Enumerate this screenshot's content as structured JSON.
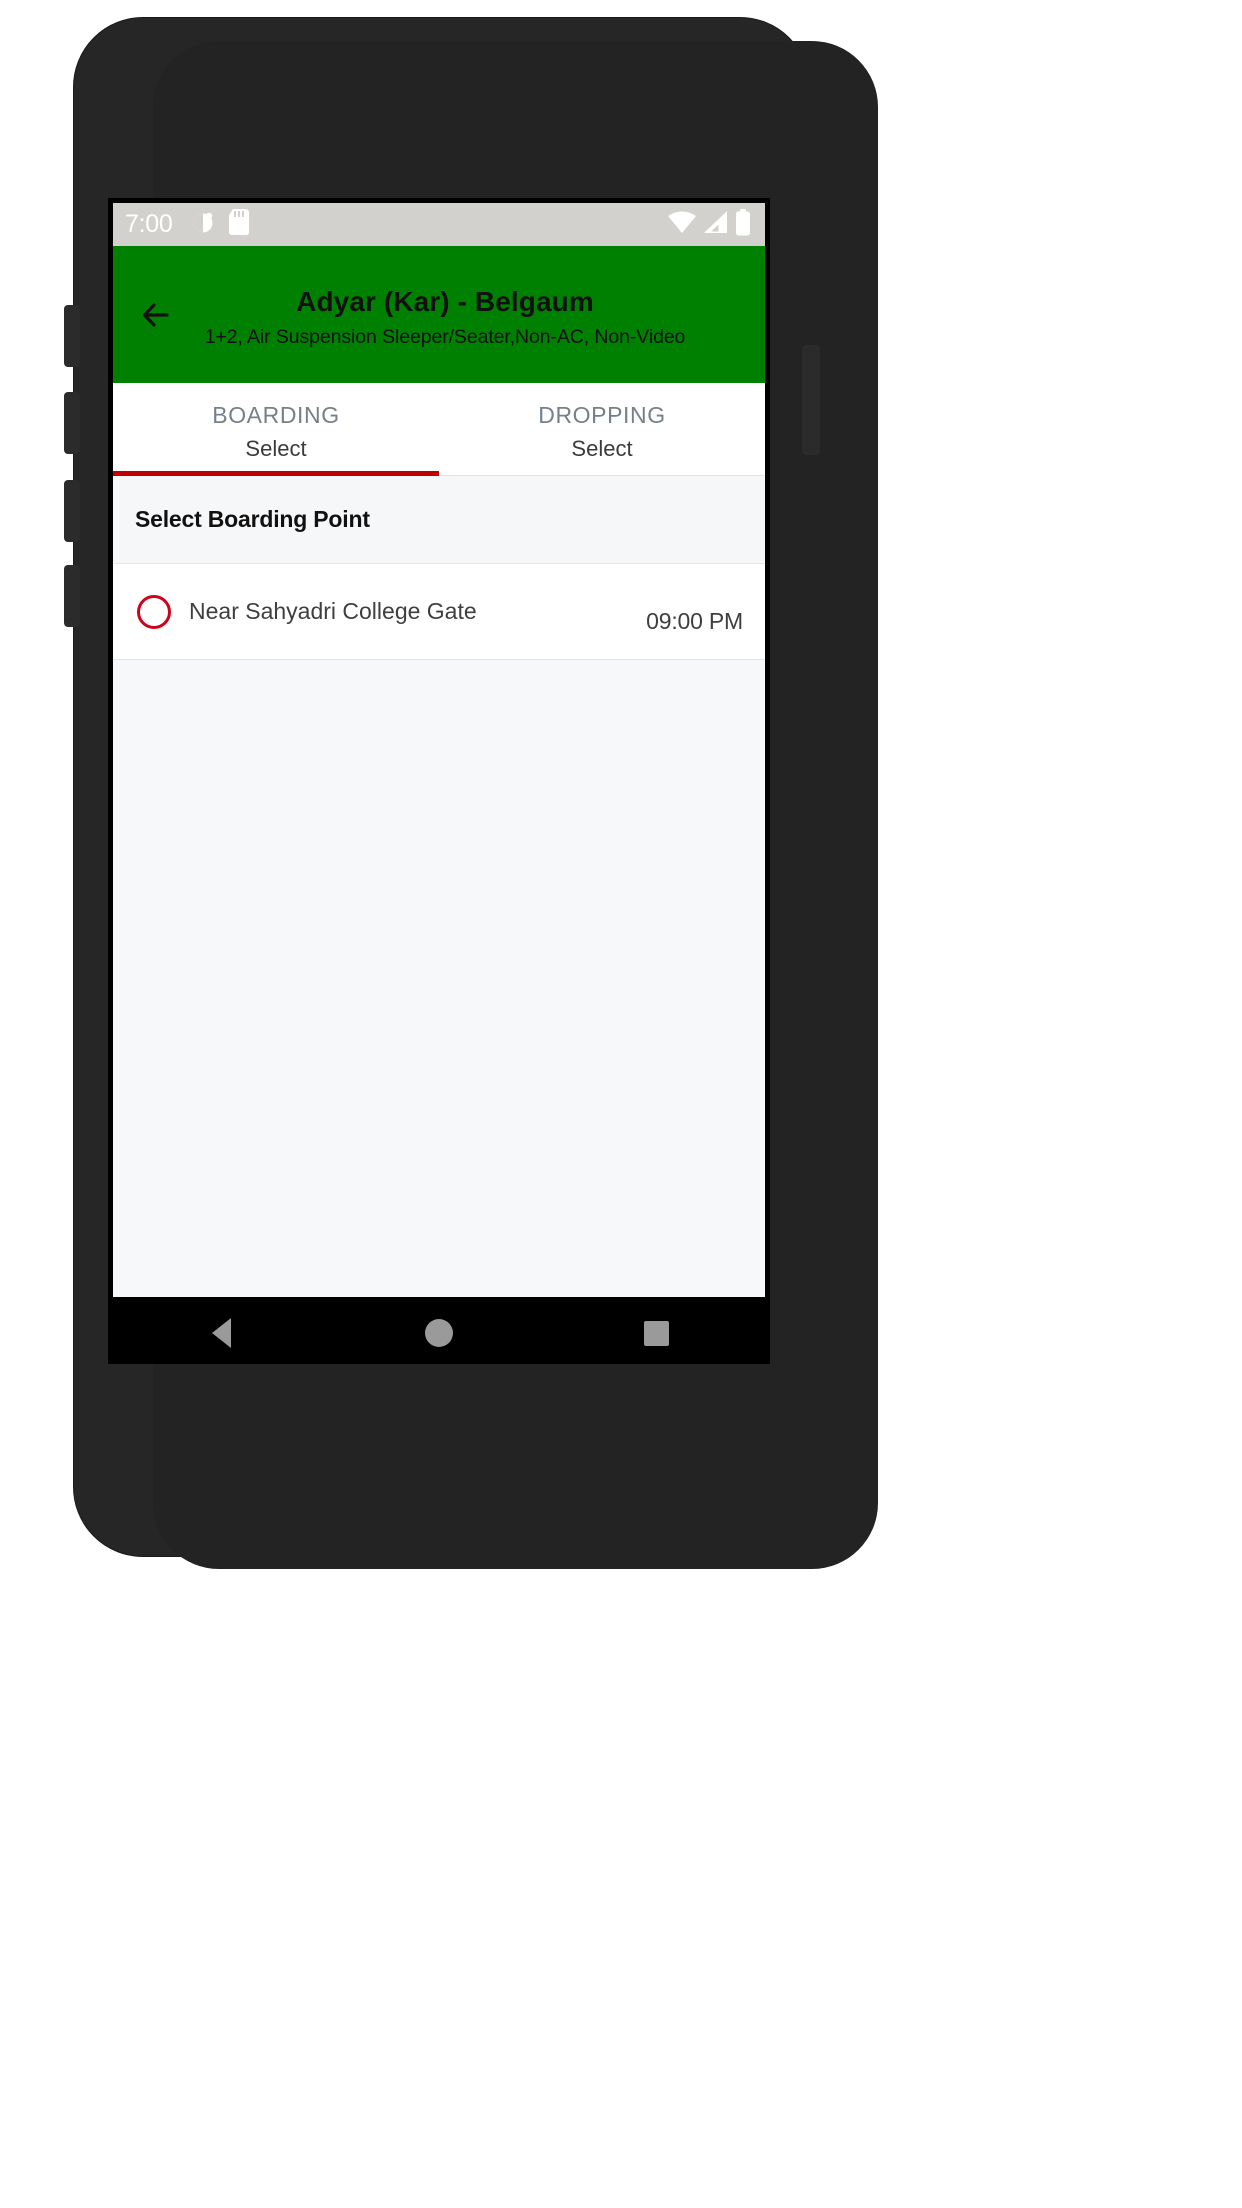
{
  "status_bar": {
    "time": "7:00",
    "left_icons": [
      "alarm-icon",
      "sd-card-icon"
    ],
    "right_icons": [
      "wifi-icon",
      "signal-icon",
      "battery-icon"
    ]
  },
  "app_bar": {
    "back_icon": "back-arrow-icon",
    "title": "Adyar (Kar) - Belgaum",
    "subtitle": "1+2, Air Suspension Sleeper/Seater,Non-AC, Non-Video",
    "background_color": "#008000"
  },
  "tabs": {
    "active_index": 0,
    "indicator_color": "#c00000",
    "items": [
      {
        "label": "BOARDING",
        "value": "Select"
      },
      {
        "label": "DROPPING",
        "value": "Select"
      }
    ]
  },
  "section": {
    "header": "Select Boarding Point"
  },
  "boarding_points": [
    {
      "name": "Near Sahyadri College Gate",
      "time": "09:00 PM",
      "selected": false,
      "radio_color": "#d0021b"
    }
  ],
  "nav_bar": {
    "buttons": [
      {
        "name": "back-nav-button",
        "icon": "triangle-back-icon"
      },
      {
        "name": "home-nav-button",
        "icon": "circle-home-icon"
      },
      {
        "name": "recents-nav-button",
        "icon": "square-recents-icon"
      }
    ]
  }
}
